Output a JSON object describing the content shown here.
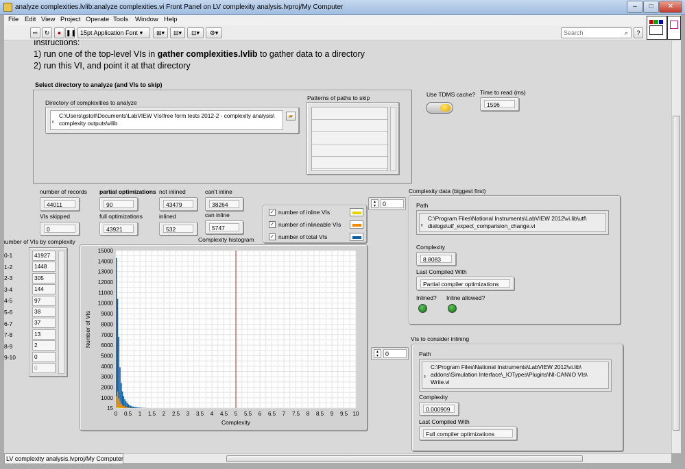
{
  "window": {
    "title": "analyze complexities.lvlib:analyze complexities.vi Front Panel on LV complexity analysis.lvproj/My Computer",
    "min": "–",
    "max": "□",
    "close": "✕"
  },
  "menu": [
    "File",
    "Edit",
    "View",
    "Project",
    "Operate",
    "Tools",
    "Window",
    "Help"
  ],
  "toolbar": {
    "font": "15pt Application Font",
    "search_placeholder": "Search",
    "help": "?"
  },
  "instructions": {
    "title": "Instructions:",
    "line1_pre": "1) run one of the top-level VIs in ",
    "line1_bold": "gather complexities.lvlib",
    "line1_post": " to gather data to a directory",
    "line2": "2) run this VI, and point it at that directory"
  },
  "select_section": {
    "title": "Select directory to analyze (and VIs to skip)",
    "dir_label": "Directory of complexities to analyze",
    "dir_value": "C:\\Users\\gstoll\\Documents\\LabVIEW VIs\\free form tests 2012-2 - complexity analysis\\ complexity outputs\\vilib",
    "skip_label": "Patterns of paths to skip"
  },
  "tdms": {
    "label": "Use TDMS cache?"
  },
  "time_to_read": {
    "label": "Time to read (ms)",
    "value": "1596"
  },
  "stats": {
    "number_of_records": {
      "label": "number of records",
      "value": "44011"
    },
    "partial_opt": {
      "label": "partial optimizations",
      "value": "90"
    },
    "not_inlined": {
      "label": "not inlined",
      "value": "43479"
    },
    "cant_inline": {
      "label": "can't inline",
      "value": "38264"
    },
    "vis_skipped": {
      "label": "VIs skipped",
      "value": "0"
    },
    "full_opt": {
      "label": "full optimizations",
      "value": "43921"
    },
    "inlined": {
      "label": "inlined",
      "value": "532"
    },
    "can_inline": {
      "label": "can inline",
      "value": "5747"
    }
  },
  "legend": [
    {
      "label": "number of inline VIs",
      "color": "#e8d200"
    },
    {
      "label": "number of inlineable VIs",
      "color": "#ef8a00"
    },
    {
      "label": "number of total VIs",
      "color": "#0b5fa5"
    }
  ],
  "vis_by_complexity": {
    "label": "number of VIs by complexity",
    "rows": [
      {
        "range": "0-1",
        "value": "41927"
      },
      {
        "range": "1-2",
        "value": "1448"
      },
      {
        "range": "2-3",
        "value": "305"
      },
      {
        "range": "3-4",
        "value": "144"
      },
      {
        "range": "4-5",
        "value": "97"
      },
      {
        "range": "5-6",
        "value": "38"
      },
      {
        "range": "6-7",
        "value": "37"
      },
      {
        "range": "7-8",
        "value": "13"
      },
      {
        "range": "8-9",
        "value": "2"
      },
      {
        "range": "9-10",
        "value": "0"
      },
      {
        "range": "",
        "value": "0"
      }
    ]
  },
  "histogram_label": "Complexity histogram",
  "chart_data": {
    "type": "bar",
    "title": "Complexity histogram",
    "xlabel": "Complexity",
    "ylabel": "Number of VIs",
    "xlim": [
      0,
      10
    ],
    "ylim": [
      15,
      15000
    ],
    "xticks": [
      "0",
      "0.5",
      "1",
      "1.5",
      "2",
      "2.5",
      "3",
      "3.5",
      "4",
      "4.5",
      "5",
      "5.5",
      "6",
      "6.5",
      "7",
      "7.5",
      "8",
      "8.5",
      "9",
      "9.5",
      "10"
    ],
    "yticks": [
      "15",
      "1000",
      "2000",
      "3000",
      "4000",
      "5000",
      "6000",
      "7000",
      "8000",
      "9000",
      "10000",
      "11000",
      "12000",
      "13000",
      "14000",
      "15000"
    ],
    "bin_width": 0.05,
    "bins_start": 0,
    "grid": true,
    "threshold_line": 5,
    "threshold_color": "#d22020",
    "series": [
      {
        "name": "number of total VIs",
        "color": "#0b5fa5",
        "values": [
          14300,
          10400,
          6800,
          3900,
          2400,
          1600,
          1150,
          850,
          650,
          500,
          380,
          300,
          240,
          190,
          150,
          120,
          100,
          85,
          70,
          60,
          50,
          42,
          36,
          30,
          25,
          22,
          18,
          15,
          13,
          11
        ]
      },
      {
        "name": "number of inlineable VIs",
        "color": "#ef8a00",
        "values": [
          1150,
          1600,
          950,
          700,
          430,
          300,
          210,
          150,
          110,
          80,
          60,
          45,
          35,
          25,
          20,
          15,
          12,
          10,
          8,
          6,
          5,
          4,
          3,
          2,
          2,
          1,
          1,
          1,
          0,
          0
        ]
      },
      {
        "name": "number of inline VIs",
        "color": "#e8d200",
        "values": [
          90,
          120,
          110,
          80,
          60,
          40,
          30,
          20,
          15,
          10,
          8,
          6,
          5,
          4,
          3,
          2,
          2,
          1,
          1,
          1,
          0,
          0,
          0,
          0,
          0,
          0,
          0,
          0,
          0,
          0
        ]
      }
    ]
  },
  "complexity_data": {
    "label": "Complexity data (biggest first)",
    "index": "0",
    "path_label": "Path",
    "path_value": "C:\\Program Files\\National Instruments\\LabVIEW 2012\\vi.lib\\utf\\ dialogs\\utf_expect_comparision_change.vi",
    "complexity_label": "Complexity",
    "complexity_value": "8.8083",
    "compiled_label": "Last Compiled With",
    "compiled_value": "Partial compiler optimizations",
    "inlined_label": "Inlined?",
    "inline_allowed_label": "Inline allowed?"
  },
  "vis_to_consider": {
    "label": "VIs to consider inlining",
    "index": "0",
    "path_label": "Path",
    "path_value": "C:\\Program Files\\National Instruments\\LabVIEW 2012\\vi.lib\\ addons\\Simulation Interface\\_IOTypes\\Plugins\\NI-CAN\\IO VIs\\ Write.vi",
    "complexity_label": "Complexity",
    "complexity_value": "0.000909",
    "compiled_label": "Last Compiled With",
    "compiled_value": "Full compiler optimizations"
  },
  "statusbar": "LV complexity analysis.lvproj/My Computer"
}
